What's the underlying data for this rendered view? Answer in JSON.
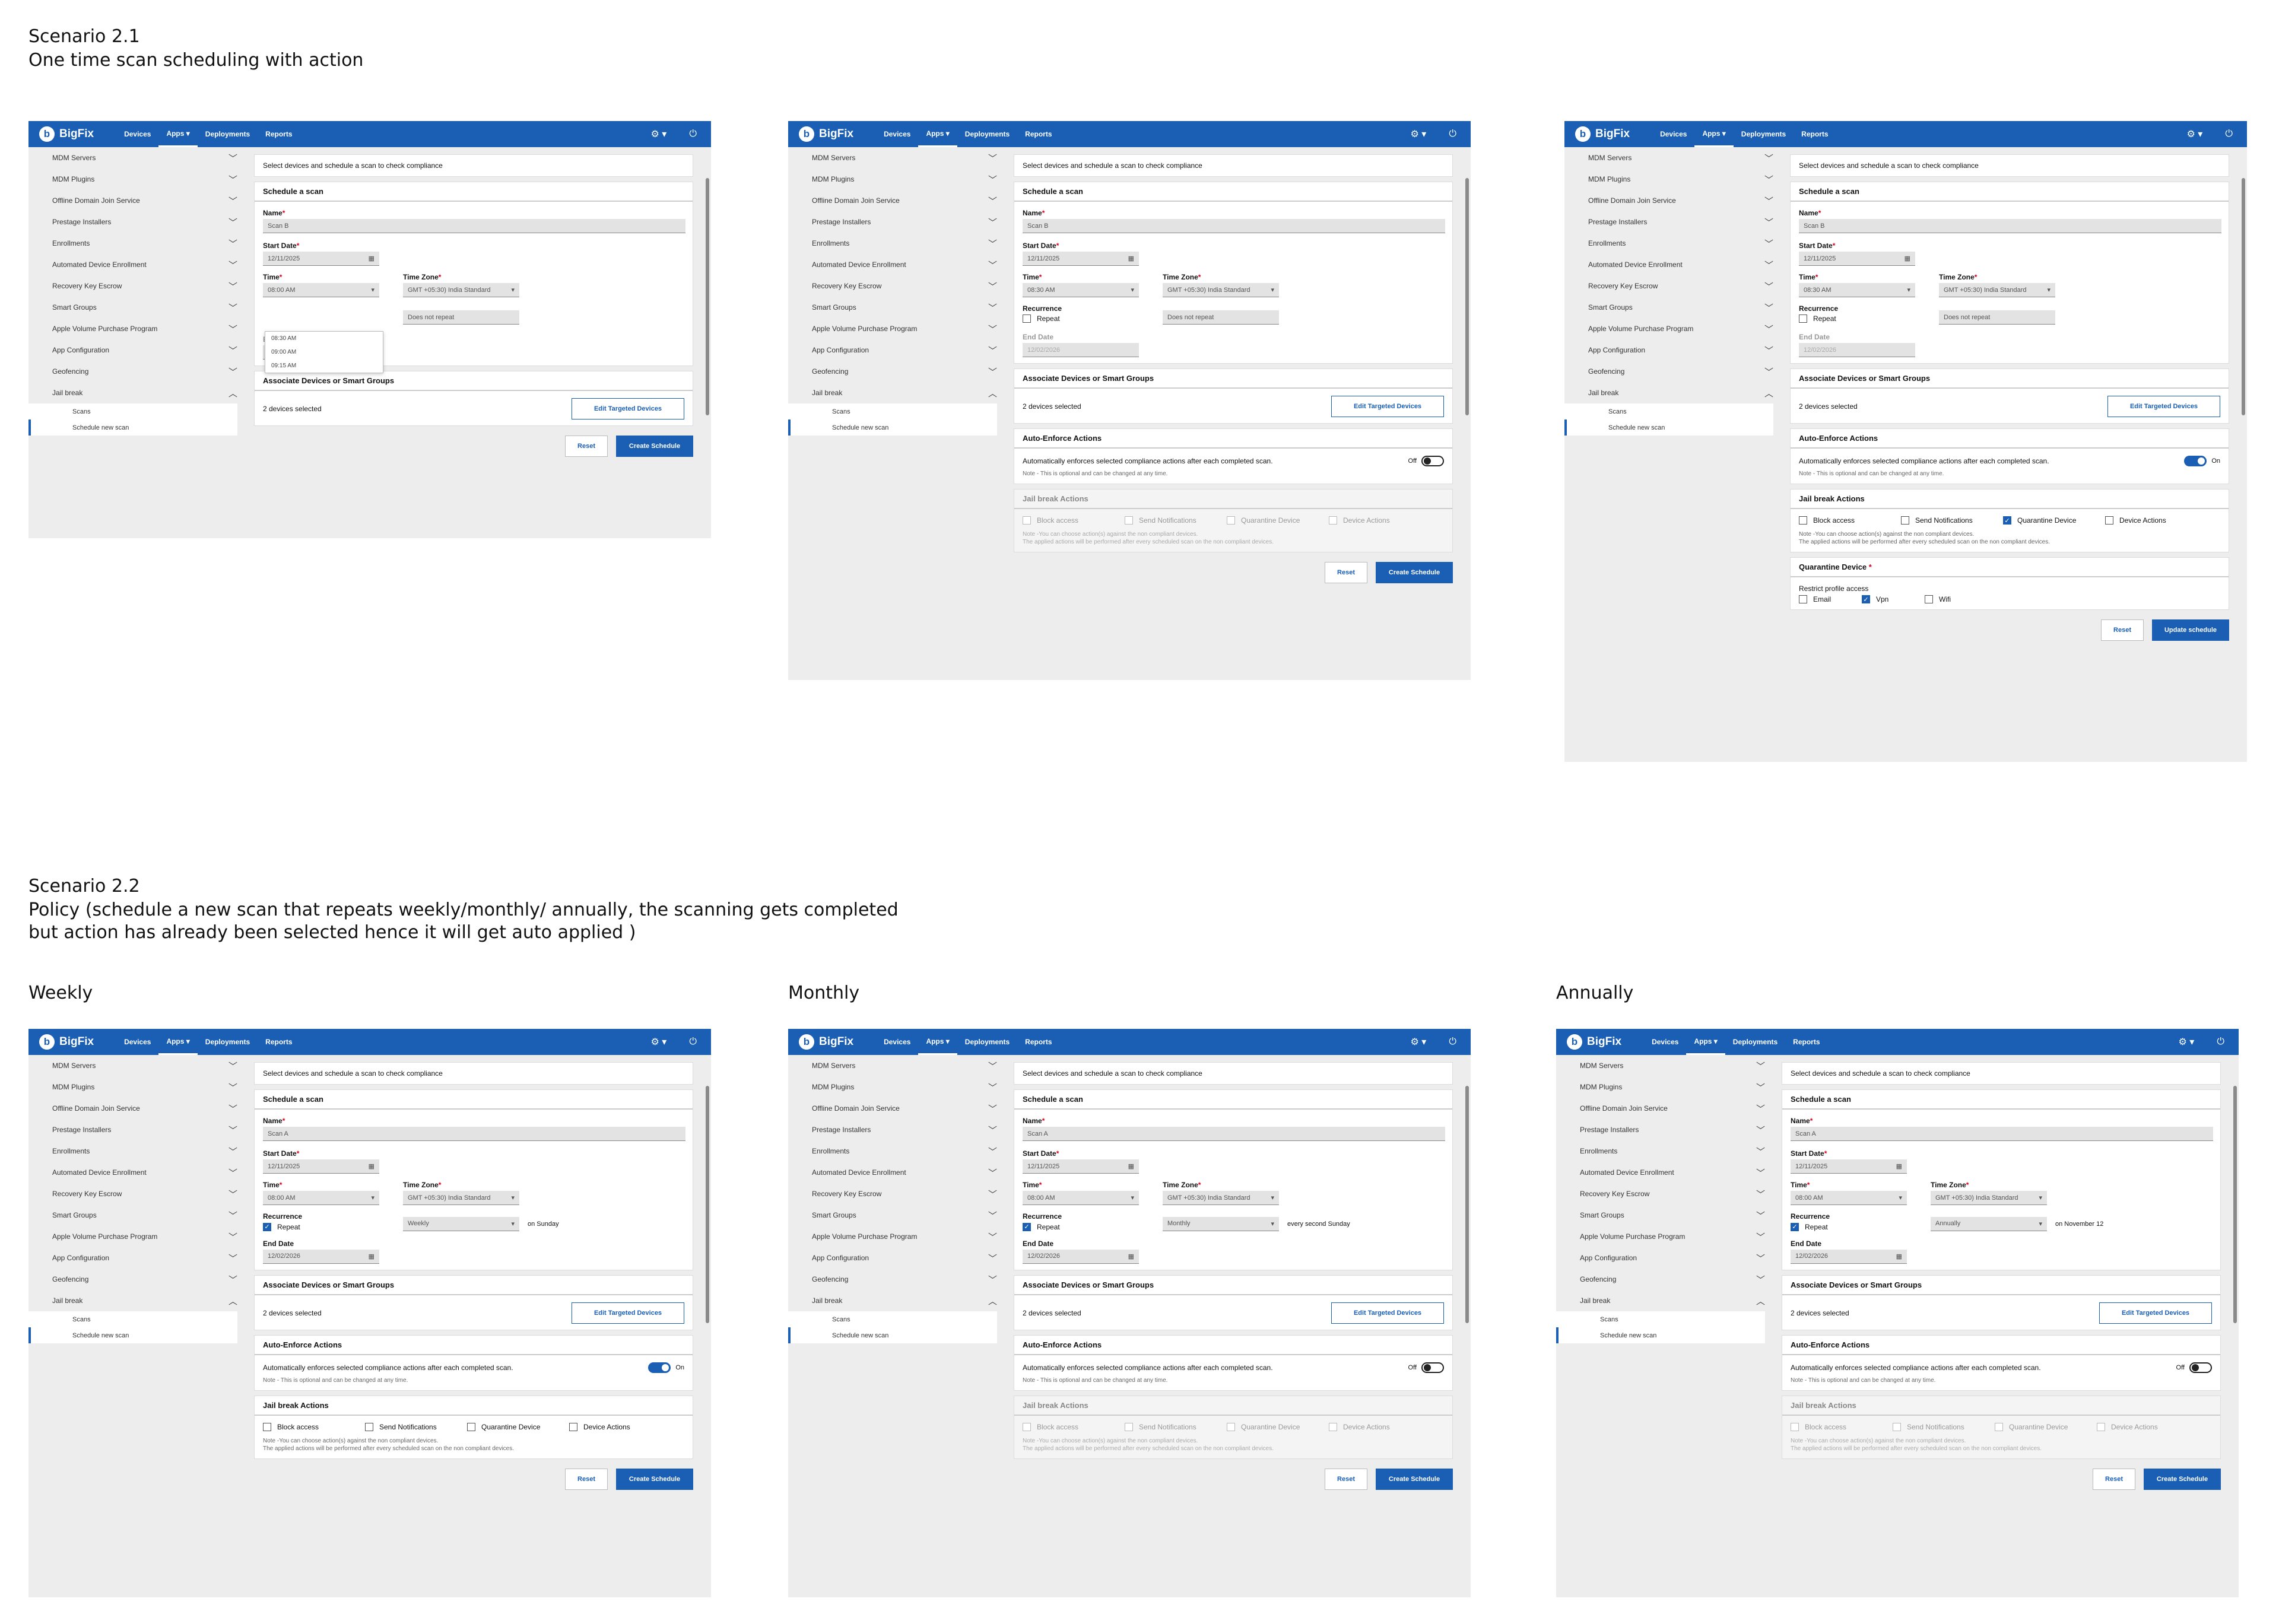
{
  "scenario21": {
    "title": "Scenario 2.1",
    "subtitle": "One time scan scheduling with action"
  },
  "scenario22": {
    "title": "Scenario 2.2",
    "subtitle_line1": "Policy (schedule a new scan that repeats weekly/monthly/ annually, the scanning gets completed",
    "subtitle_line2": "but action has already been selected hence it will get auto applied  )"
  },
  "columns": {
    "weekly": "Weekly",
    "monthly": "Monthly",
    "annually": "Annually"
  },
  "app": {
    "logo_letter": "b",
    "logo": "BigFix",
    "nav": [
      "Devices",
      "Apps ▾",
      "Deployments",
      "Reports"
    ],
    "settings_icon": "⚙ ▾",
    "power_icon": "⏻",
    "sidebar": [
      "MDM Servers",
      "MDM Plugins",
      "Offline Domain Join Service",
      "Prestage Installers",
      "Enrollments",
      "Automated Device Enrollment",
      "Recovery Key Escrow",
      "Smart Groups",
      "Apple Volume Purchase Program",
      "App Configuration",
      "Geofencing"
    ],
    "sidebar_open": "Jail break",
    "sidebar_sub": [
      "Scans",
      "Schedule new scan"
    ],
    "intro": "Select devices and schedule a scan to check compliance",
    "schedule_title": "Schedule a scan",
    "name_label": "Name",
    "start_label": "Start Date",
    "start_date": "12/11/2025",
    "time_label": "Time",
    "tz_label": "Time Zone",
    "tz_value": "GMT +05:30) India Standard",
    "recurrence_label": "Recurrence",
    "repeat_label": "Repeat",
    "no_repeat": "Does not repeat",
    "end_label": "End Date",
    "end_date": "12/02/2026",
    "associate_title": "Associate Devices or Smart Groups",
    "devices_selected": "2 devices selected",
    "edit_targeted": "Edit  Targeted Devices",
    "auto_title": "Auto-Enforce Actions",
    "auto_desc": "Automatically enforces selected compliance actions after each completed scan.",
    "auto_note": "Note - This is optional and can be changed at any time.",
    "off": "Off",
    "on": "On",
    "jail_title": "Jail break Actions",
    "actions": [
      "Block access",
      "Send Notifications",
      "Quarantine Device",
      "Device Actions"
    ],
    "jail_note1": "Note -You can choose action(s) against the non compliant devices.",
    "jail_note2": "The applied actions will be performed after every scheduled scan on the non compliant devices.",
    "quarantine_title": "Quarantine Device",
    "restrict_label": "Restrict profile access",
    "restrict_opts": [
      "Email",
      "Vpn",
      "Wifi"
    ],
    "reset": "Reset",
    "create": "Create Schedule",
    "update": "Update schedule",
    "time_options": [
      "08:30 AM",
      "09:00 AM",
      "09:15 AM"
    ]
  },
  "screens": {
    "s1": {
      "name": "Scan B",
      "time": "08:00 AM"
    },
    "s2": {
      "name": "Scan B",
      "time": "08:30 AM"
    },
    "s3": {
      "name": "Scan B",
      "time": "08:30 AM"
    },
    "w": {
      "name": "Scan A",
      "time": "08:00 AM",
      "freq": "Weekly",
      "freq_note": "on Sunday"
    },
    "m": {
      "name": "Scan A",
      "time": "08:00 AM",
      "freq": "Monthly",
      "freq_note": "every second Sunday"
    },
    "a": {
      "name": "Scan A",
      "time": "08:00 AM",
      "freq": "Annually",
      "freq_note": "on November 12"
    }
  }
}
